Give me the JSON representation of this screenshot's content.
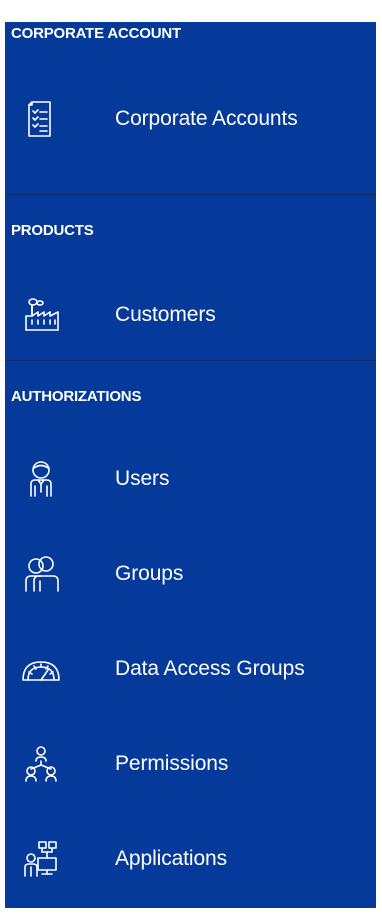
{
  "sections": [
    {
      "header": "CORPORATE ACCOUNT",
      "items": [
        {
          "label": "Corporate Accounts",
          "icon": "document-list-icon"
        }
      ]
    },
    {
      "header": "PRODUCTS",
      "items": [
        {
          "label": "Customers",
          "icon": "factory-icon"
        }
      ]
    },
    {
      "header": "AUTHORIZATIONS",
      "items": [
        {
          "label": "Users",
          "icon": "user-icon"
        },
        {
          "label": "Groups",
          "icon": "group-icon"
        },
        {
          "label": "Data Access Groups",
          "icon": "gauge-icon"
        },
        {
          "label": "Permissions",
          "icon": "org-chart-icon"
        },
        {
          "label": "Applications",
          "icon": "applications-icon"
        }
      ]
    }
  ],
  "colors": {
    "background": "#053a9a",
    "divider": "#0c2f6d",
    "text": "#ffffff"
  }
}
